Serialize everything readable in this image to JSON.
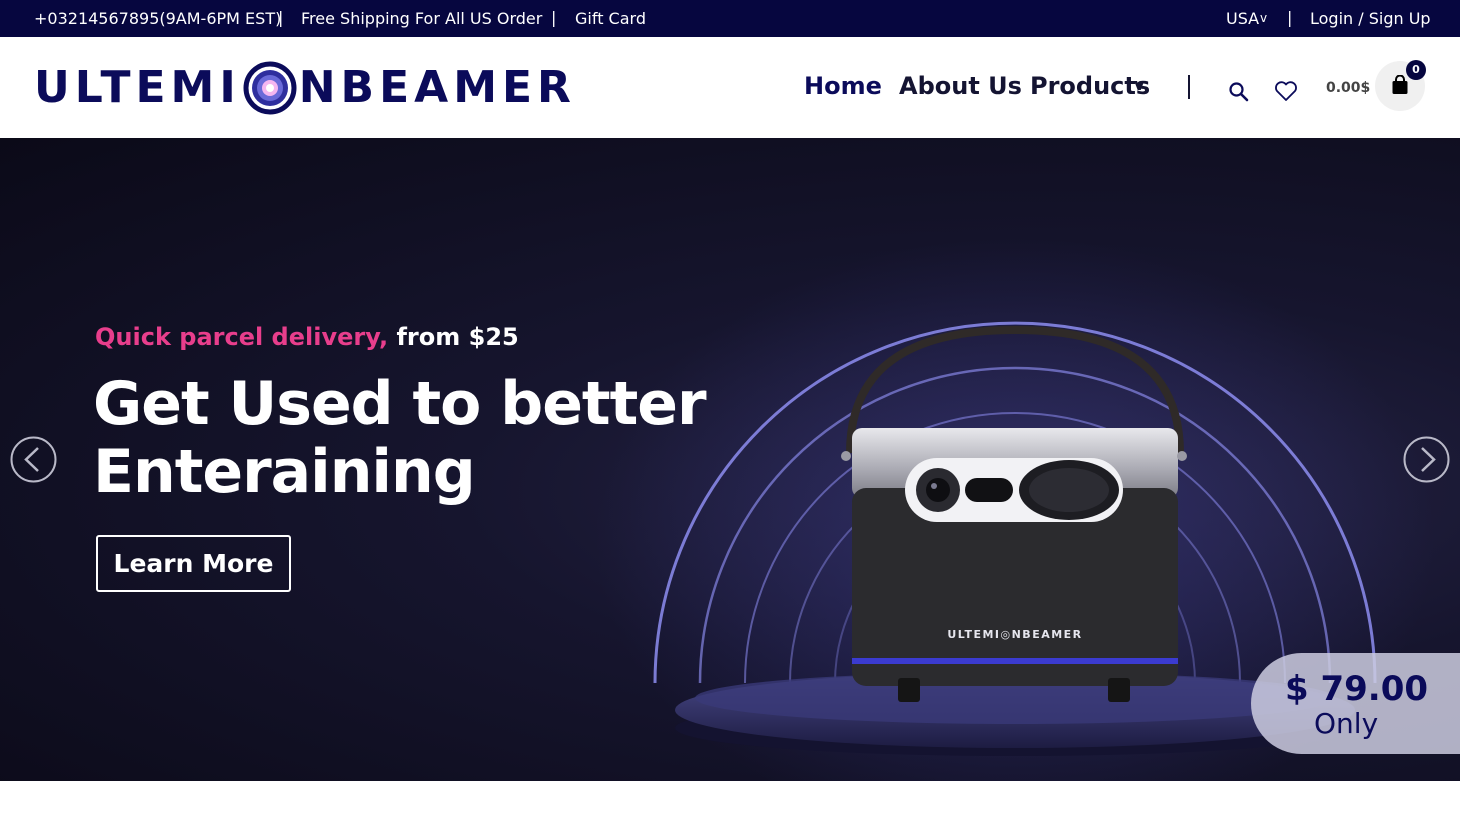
{
  "topbar": {
    "phone": "+03214567895(9AM-6PM EST)",
    "separator": "|",
    "shipping": "Free Shipping For All US Order",
    "gift_card": "Gift Card",
    "region": "USA",
    "region_caret": "v",
    "auth": "Login / Sign Up"
  },
  "header": {
    "logo_left": "ULTEMI",
    "logo_right": "NBEAMER",
    "nav": {
      "home": "Home",
      "about": "About Us",
      "products": "Products",
      "products_caret": "v"
    },
    "cart_total": "0.00$",
    "cart_count": "0",
    "icons": {
      "search": "search-icon",
      "wishlist": "heart-icon",
      "cart": "shopping-bag-icon"
    }
  },
  "hero": {
    "tagline_highlight": "Quick parcel delivery,",
    "tagline_rest": "from $25",
    "headline": "Get Used to better Enteraining",
    "cta": "Learn More",
    "price": "$ 79.00",
    "price_suffix": "Only",
    "product_brand": "ULTEMI◎NBEAMER",
    "colors": {
      "accent": "#e83e8c",
      "brand_navy": "#06063f"
    }
  }
}
